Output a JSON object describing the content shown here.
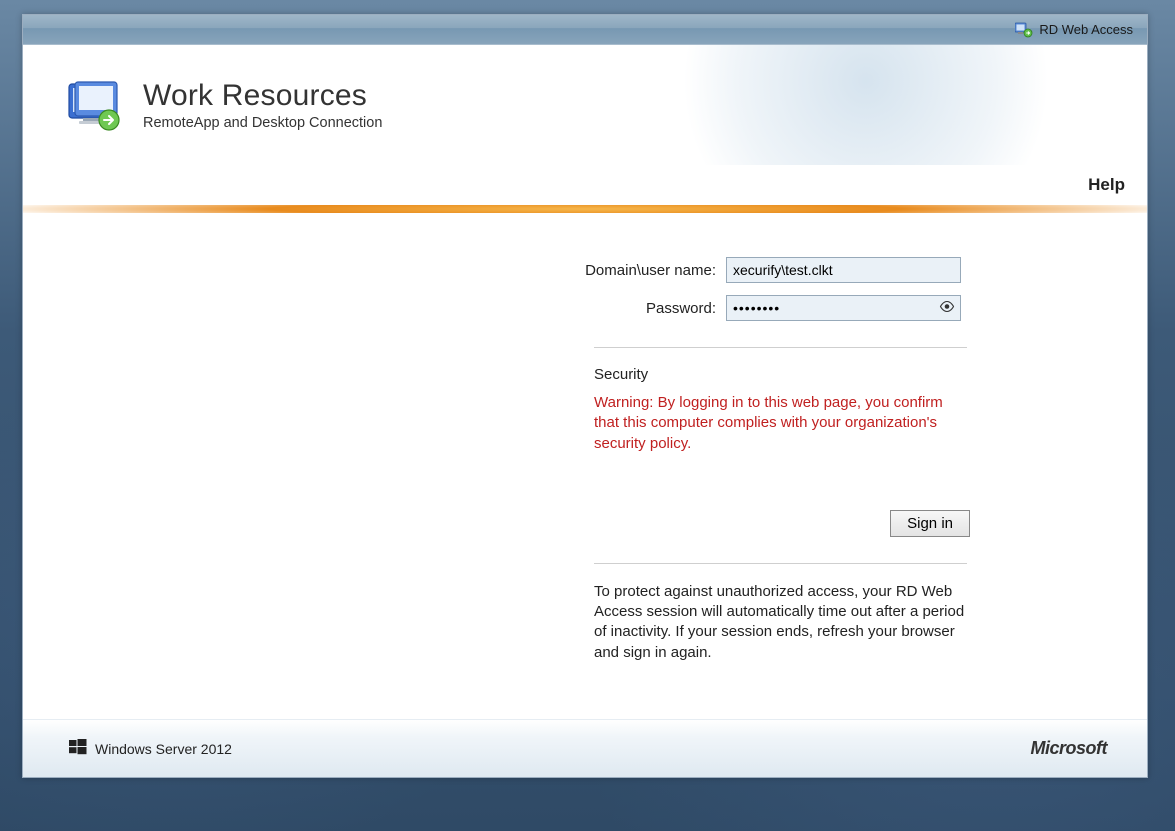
{
  "topbar": {
    "label": "RD Web Access"
  },
  "header": {
    "title": "Work Resources",
    "subtitle": "RemoteApp and Desktop Connection"
  },
  "help": {
    "label": "Help"
  },
  "form": {
    "username_label": "Domain\\user name:",
    "username_value": "xecurify\\test.clkt",
    "password_label": "Password:",
    "password_value": "••••••••"
  },
  "security": {
    "heading": "Security",
    "warning": "Warning: By logging in to this web page, you confirm that this computer complies with your organization's security policy."
  },
  "signin": {
    "label": "Sign in"
  },
  "timeout_notice": "To protect against unauthorized access, your RD Web Access session will automatically time out after a period of inactivity. If your session ends, refresh your browser and sign in again.",
  "footer": {
    "product": "Windows Server 2012",
    "vendor": "Microsoft"
  }
}
